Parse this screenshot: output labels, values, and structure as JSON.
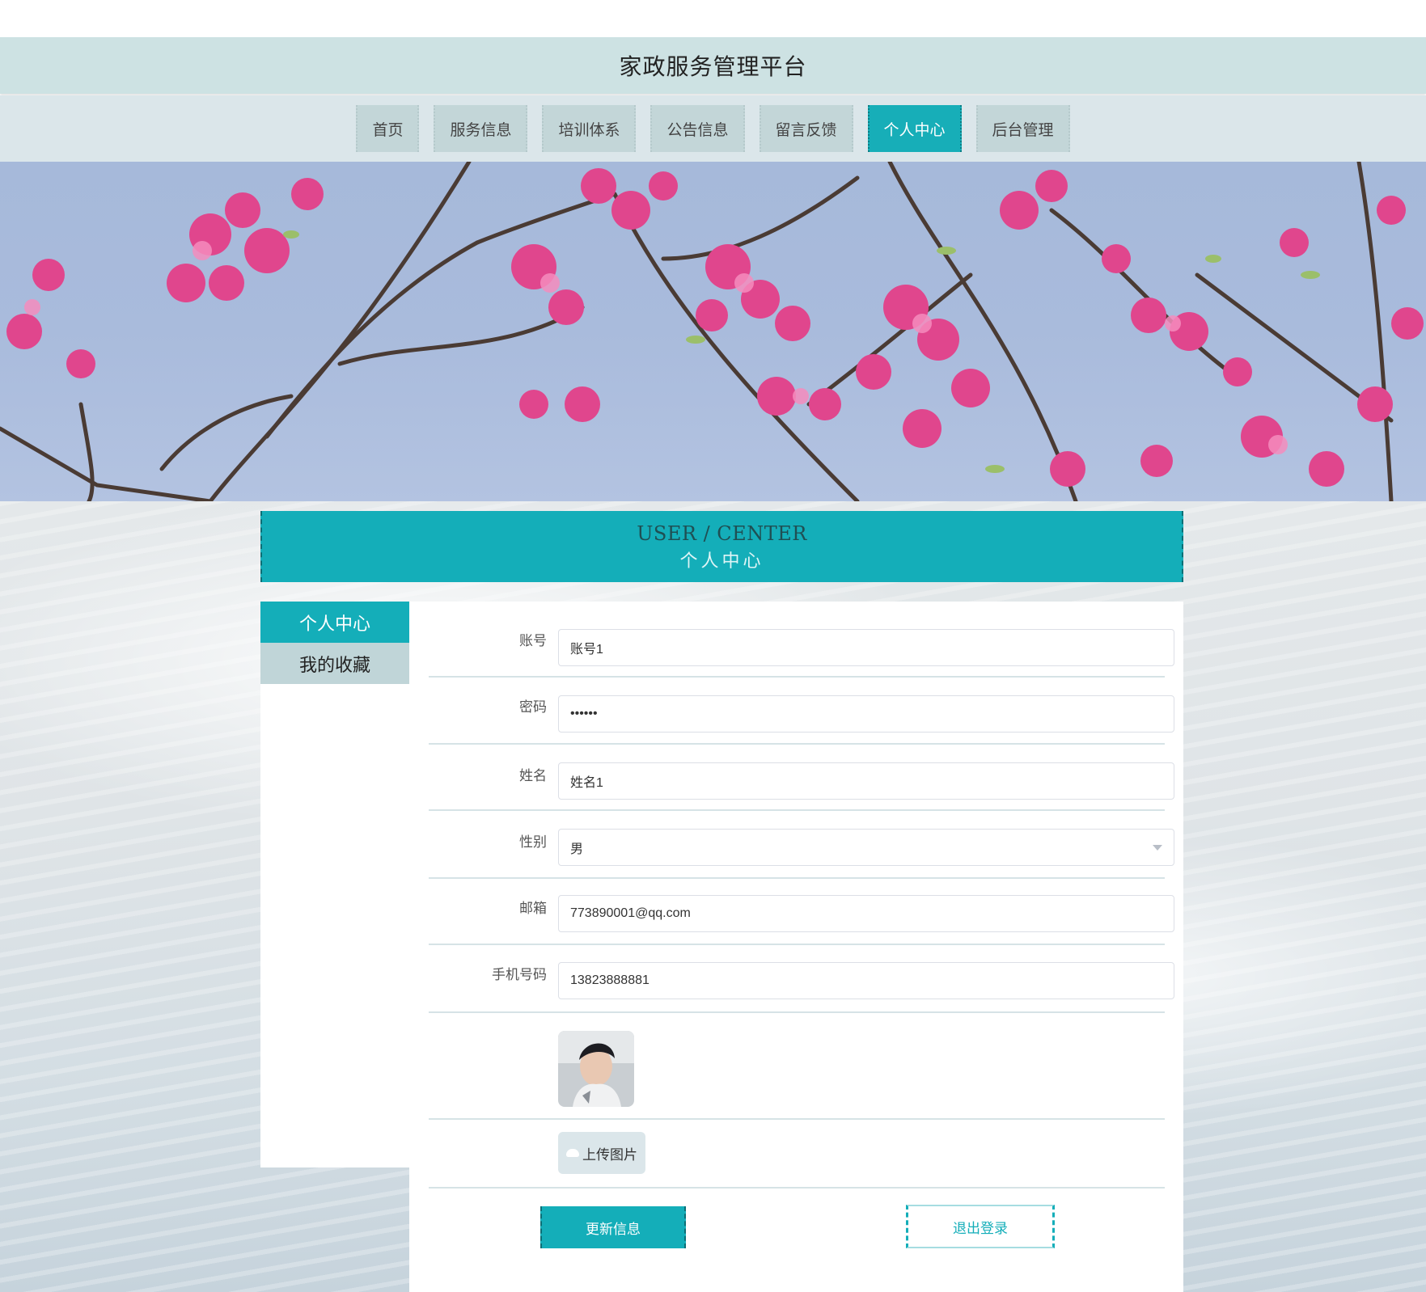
{
  "site": {
    "title": "家政服务管理平台"
  },
  "nav": {
    "items": [
      {
        "label": "首页",
        "active": false
      },
      {
        "label": "服务信息",
        "active": false
      },
      {
        "label": "培训体系",
        "active": false
      },
      {
        "label": "公告信息",
        "active": false
      },
      {
        "label": "留言反馈",
        "active": false
      },
      {
        "label": "个人中心",
        "active": true
      },
      {
        "label": "后台管理",
        "active": false
      }
    ]
  },
  "section": {
    "title_en": "USER / CENTER",
    "title_cn": "个人中心"
  },
  "sidebar": {
    "items": [
      {
        "label": "个人中心",
        "active": true
      },
      {
        "label": "我的收藏",
        "active": false
      }
    ]
  },
  "form": {
    "account": {
      "label": "账号",
      "value": "账号1"
    },
    "password": {
      "label": "密码",
      "value": "••••••"
    },
    "name": {
      "label": "姓名",
      "value": "姓名1"
    },
    "gender": {
      "label": "性别",
      "value": "男"
    },
    "email": {
      "label": "邮箱",
      "value": "773890001@qq.com"
    },
    "phone": {
      "label": "手机号码",
      "value": "13823888881"
    },
    "upload_label": "上传图片"
  },
  "actions": {
    "update_label": "更新信息",
    "logout_label": "退出登录"
  },
  "colors": {
    "accent": "#14aeb9",
    "nav_bg": "#c3d6d8",
    "title_bg": "#cde2e3"
  }
}
